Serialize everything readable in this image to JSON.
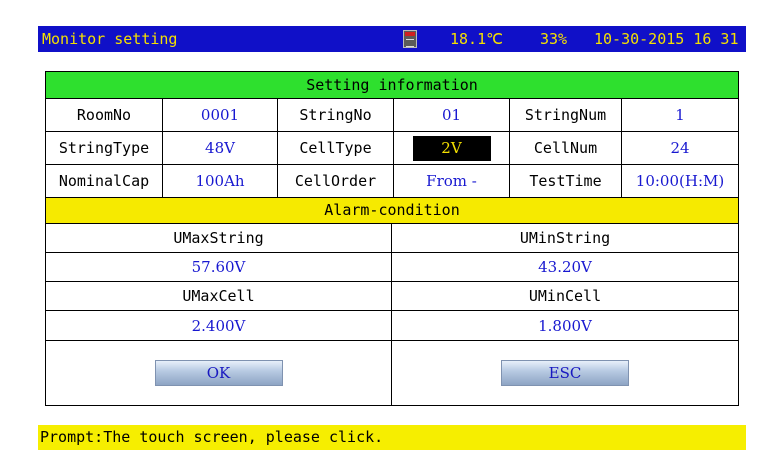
{
  "header": {
    "title": "Monitor setting",
    "temperature": "18.1℃",
    "percent": "33%",
    "datetime": "10-30-2015 16 31"
  },
  "setting": {
    "heading": "Setting information",
    "rows": [
      [
        {
          "label": "RoomNo",
          "value": "0001"
        },
        {
          "label": "StringNo",
          "value": "01"
        },
        {
          "label": "StringNum",
          "value": "1"
        }
      ],
      [
        {
          "label": "StringType",
          "value": "48V"
        },
        {
          "label": "CellType",
          "value": "2V"
        },
        {
          "label": "CellNum",
          "value": "24"
        }
      ],
      [
        {
          "label": "NominalCap",
          "value": "100Ah"
        },
        {
          "label": "CellOrder",
          "value": "From -"
        },
        {
          "label": "TestTime",
          "value": "10:00(H:M)"
        }
      ]
    ]
  },
  "alarm": {
    "heading": "Alarm-condition",
    "umax_string_label": "UMaxString",
    "umin_string_label": "UMinString",
    "umax_string_value": "57.60V",
    "umin_string_value": "43.20V",
    "umax_cell_label": "UMaxCell",
    "umin_cell_label": "UMinCell",
    "umax_cell_value": "2.400V",
    "umin_cell_value": "1.800V"
  },
  "buttons": {
    "ok": "OK",
    "esc": "ESC"
  },
  "prompt": "Prompt:The touch screen, please click.",
  "icons": {
    "storage": "sd-card-icon"
  },
  "colors": {
    "title_bar": "#1010c8",
    "title_text": "#f4e000",
    "setting_band": "#2ee02e",
    "alarm_band": "#f6ea00",
    "value_text": "#1818d0",
    "selected_bg": "#000000",
    "selected_text": "#f4e000",
    "prompt_bar": "#f6ee00"
  }
}
